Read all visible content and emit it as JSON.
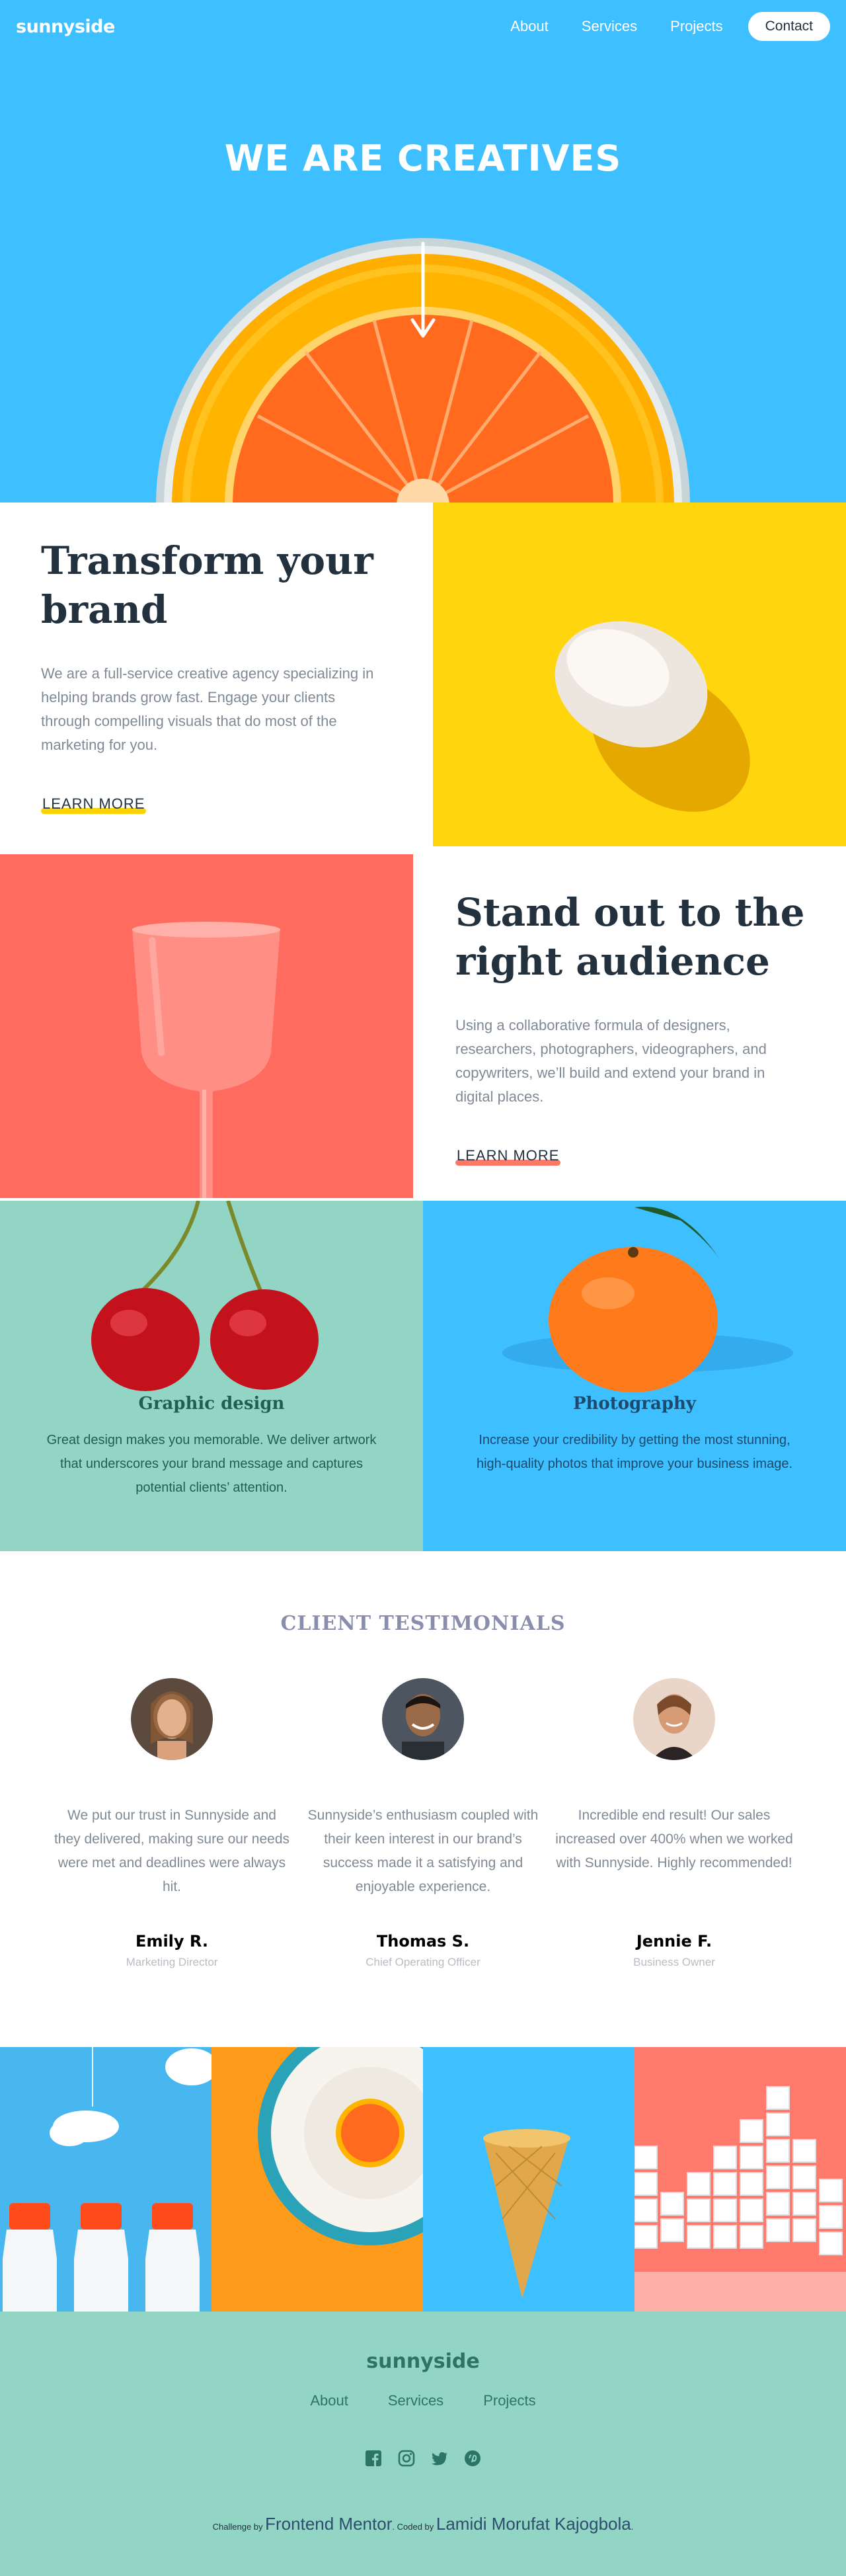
{
  "nav": {
    "logo": "sunnyside",
    "links": [
      "About",
      "Services",
      "Projects"
    ],
    "contact": "Contact"
  },
  "hero": {
    "title": "WE ARE CREATIVES",
    "arrow_icon": "arrow-down-icon"
  },
  "features": [
    {
      "title": "Transform your brand",
      "body": "We are a full-service creative agency specializing in helping brands grow fast. Engage your clients through compelling visuals that do most of the marketing for you.",
      "cta": "Learn more",
      "accent": "#fad400"
    },
    {
      "title": "Stand out to the right audience",
      "body": "Using a collaborative formula of designers, researchers, photographers, videographers, and copywriters, we’ll build and extend your brand in digital places.",
      "cta": "Learn more",
      "accent": "#fe7865"
    }
  ],
  "services": [
    {
      "title": "Graphic design",
      "body": "Great design makes you memorable. We deliver artwork that underscores your brand message and captures potential clients’ attention."
    },
    {
      "title": "Photography",
      "body": "Increase your credibility by getting the most stunning, high-quality photos that improve your business image."
    }
  ],
  "testimonials": {
    "heading": "CLIENT TESTIMONIALS",
    "items": [
      {
        "quote": "We put our trust in Sunnyside and they delivered, making sure our needs were met and deadlines were always hit.",
        "name": "Emily R.",
        "role": "Marketing Director"
      },
      {
        "quote": "Sunnyside’s enthusiasm coupled with their keen interest in our brand’s success made it a satisfying and enjoyable experience.",
        "name": "Thomas S.",
        "role": "Chief Operating Officer"
      },
      {
        "quote": "Incredible end result! Our sales increased over 400% when we worked with Sunnyside. Highly recommended!",
        "name": "Jennie F.",
        "role": "Business Owner"
      }
    ]
  },
  "footer": {
    "logo": "sunnyside",
    "links": [
      "About",
      "Services",
      "Projects"
    ],
    "social_icons": [
      "facebook-icon",
      "instagram-icon",
      "twitter-icon",
      "pinterest-icon"
    ],
    "attribution_prefix": "Challenge by",
    "attribution_link": "Frontend Mentor",
    "attribution_coded": "Coded by",
    "attribution_author": "Lamidi Morufat Kajogbola"
  },
  "colors": {
    "hero_blue": "#3ebfff",
    "egg_yellow": "#ffd60d",
    "glass_coral": "#ff6b5f",
    "cherry_mint": "#93d5c5",
    "footer_green": "#2c7566"
  }
}
